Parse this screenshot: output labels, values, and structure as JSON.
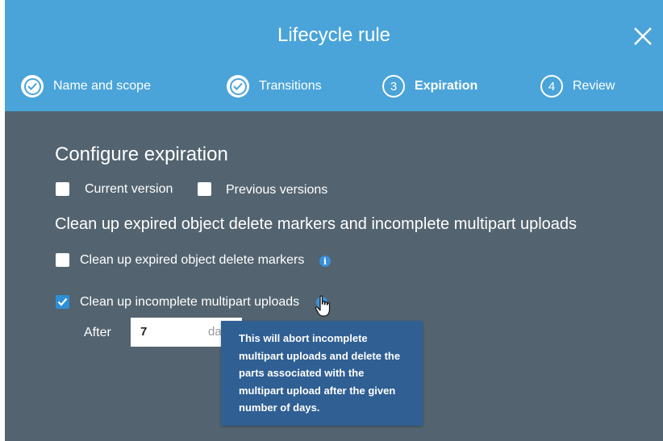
{
  "dialog": {
    "title": "Lifecycle rule"
  },
  "steps": [
    {
      "label": "Name and scope",
      "state": "done",
      "number": ""
    },
    {
      "label": "Transitions",
      "state": "done",
      "number": ""
    },
    {
      "label": "Expiration",
      "state": "active",
      "number": "3"
    },
    {
      "label": "Review",
      "state": "pending",
      "number": "4"
    }
  ],
  "main": {
    "heading": "Configure expiration",
    "current_version_label": "Current version",
    "previous_versions_label": "Previous versions",
    "cleanup_heading": "Clean up expired object delete markers and incomplete multipart uploads",
    "delete_markers_label": "Clean up expired object delete markers",
    "multipart_label": "Clean up incomplete multipart uploads",
    "multipart_checked": true,
    "after_label": "After",
    "days_value": "7",
    "days_unit": "da"
  },
  "tooltip": {
    "text": "This will abort incomplete multipart uploads and delete the parts associated with the multipart upload after the given number of days."
  },
  "colors": {
    "header": "#4aa4d9",
    "body": "#536470",
    "tooltip": "#2f5f93",
    "checkbox_checked": "#2d8fd5"
  }
}
